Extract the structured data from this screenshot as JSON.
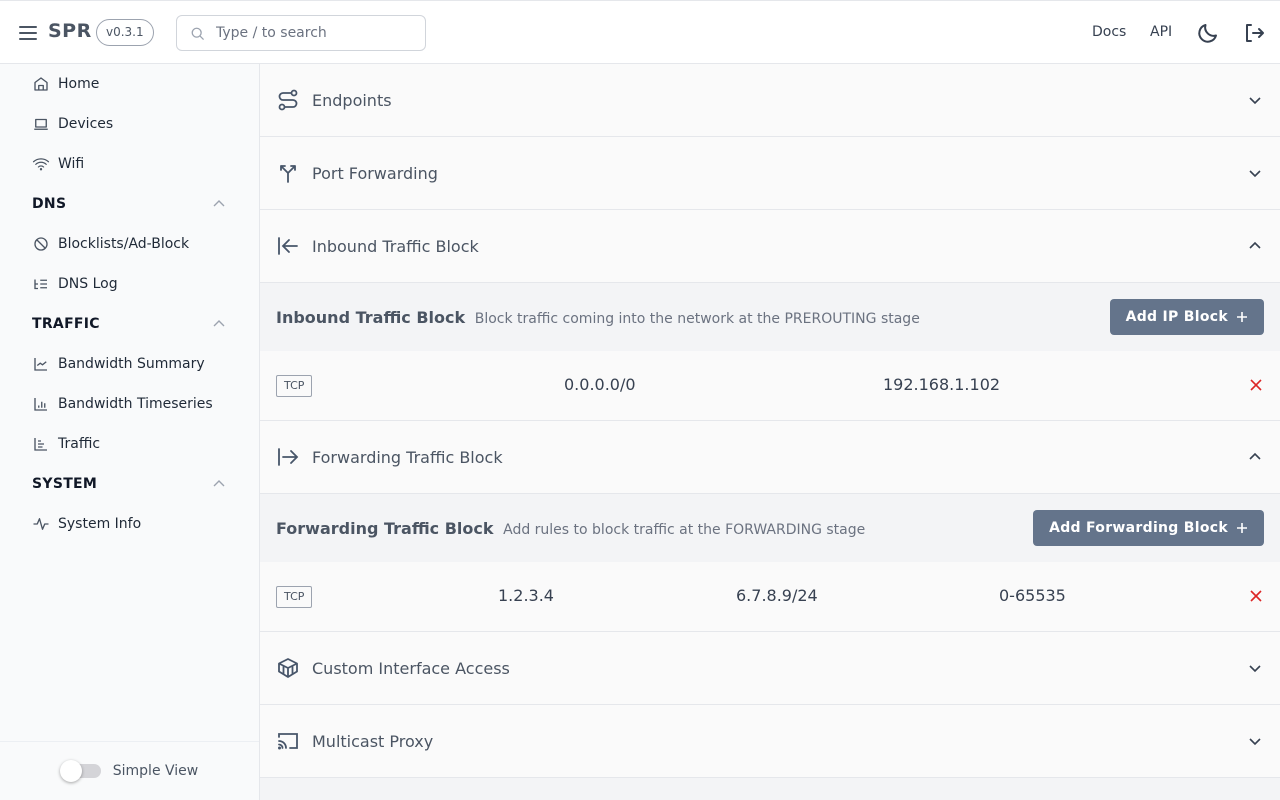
{
  "header": {
    "brand": "SPR",
    "version": "v0.3.1",
    "search_placeholder": "Type / to search",
    "links": [
      "Docs",
      "API"
    ]
  },
  "sidebar": {
    "items_top": [
      {
        "label": "Home",
        "icon": "home-icon"
      },
      {
        "label": "Devices",
        "icon": "laptop-icon"
      },
      {
        "label": "Wifi",
        "icon": "wifi-icon"
      }
    ],
    "sections": [
      {
        "title": "DNS",
        "expanded": true,
        "items": [
          {
            "label": "Blocklists/Ad-Block",
            "icon": "ban-icon"
          },
          {
            "label": "DNS Log",
            "icon": "list-icon"
          }
        ]
      },
      {
        "title": "TRAFFIC",
        "expanded": true,
        "items": [
          {
            "label": "Bandwidth Summary",
            "icon": "line-chart-icon"
          },
          {
            "label": "Bandwidth Timeseries",
            "icon": "bar-chart-icon"
          },
          {
            "label": "Traffic",
            "icon": "align-chart-icon"
          }
        ]
      },
      {
        "title": "SYSTEM",
        "expanded": true,
        "items": [
          {
            "label": "System Info",
            "icon": "activity-icon"
          }
        ]
      }
    ],
    "footer": {
      "toggle_label": "Simple View",
      "toggle_on": false
    }
  },
  "main": {
    "sections": [
      {
        "title": "Endpoints",
        "expanded": false
      },
      {
        "title": "Port Forwarding",
        "expanded": false
      },
      {
        "title": "Inbound Traffic Block",
        "expanded": true
      },
      {
        "title": "Forwarding Traffic Block",
        "expanded": true
      },
      {
        "title": "Custom Interface Access",
        "expanded": false
      },
      {
        "title": "Multicast Proxy",
        "expanded": false
      }
    ],
    "inbound": {
      "title": "Inbound Traffic Block",
      "description": "Block traffic coming into the network at the PREROUTING stage",
      "button": "Add IP Block",
      "rows": [
        {
          "protocol": "TCP",
          "src": "0.0.0.0/0",
          "dst": "192.168.1.102"
        }
      ]
    },
    "forwarding": {
      "title": "Forwarding Traffic Block",
      "description": "Add rules to block traffic at the FORWARDING stage",
      "button": "Add Forwarding Block",
      "rows": [
        {
          "protocol": "TCP",
          "src": "1.2.3.4",
          "dst": "6.7.8.9/24",
          "ports": "0-65535"
        }
      ]
    }
  },
  "colors": {
    "button_bg": "#64748b",
    "delete": "#dc2626",
    "icon": "#475569"
  }
}
